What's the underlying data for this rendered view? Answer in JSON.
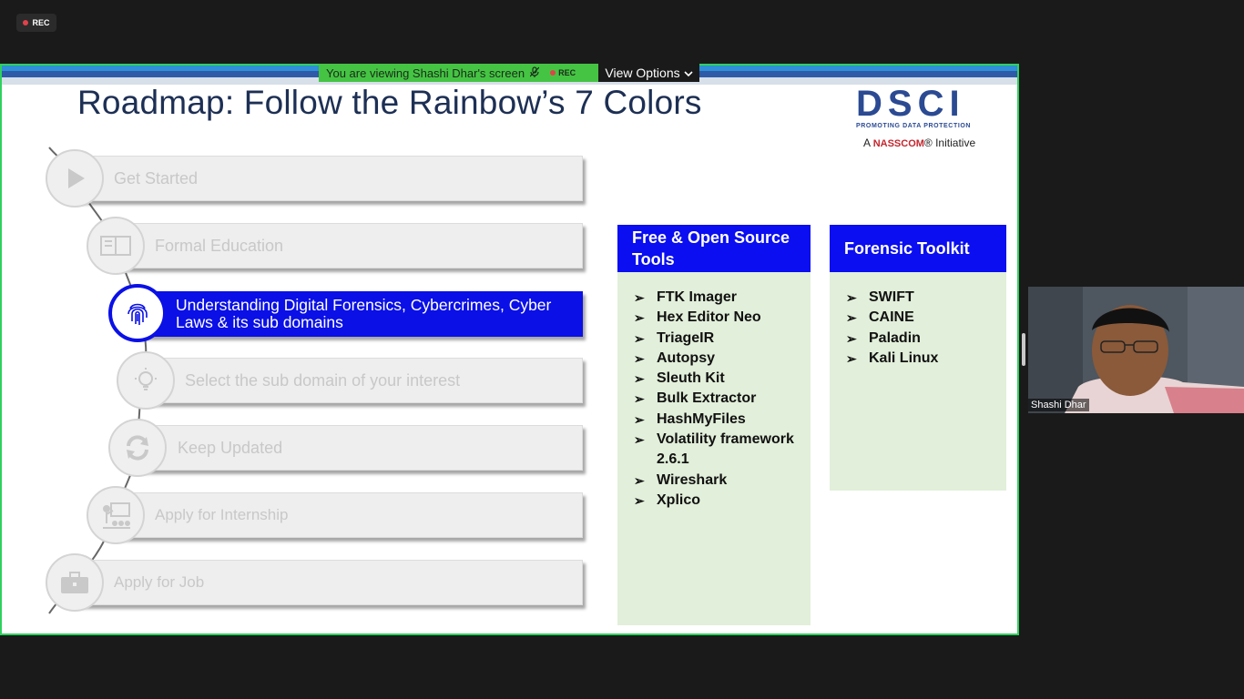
{
  "meeting": {
    "rec_label": "REC",
    "viewing_banner": "You are viewing Shashi Dhar's screen",
    "banner_rec_label": "REC",
    "view_options_label": "View Options",
    "participant_name": "Shashi Dhar"
  },
  "slide": {
    "title": "Roadmap: Follow the Rainbow’s 7 Colors",
    "logo": {
      "brand": "DSCI",
      "tagline": "PROMOTING DATA PROTECTION",
      "nasscom_prefix": "A",
      "nasscom_brand": "NASSCOM",
      "nasscom_suffix": "® Initiative"
    },
    "steps": [
      {
        "label": "Get Started",
        "icon": "play-icon",
        "active": false
      },
      {
        "label": "Formal Education",
        "icon": "book-icon",
        "active": false
      },
      {
        "label": "Understanding Digital Forensics, Cybercrimes, Cyber Laws & its sub domains",
        "icon": "fingerprint-icon",
        "active": true
      },
      {
        "label": "Select the sub domain of your interest",
        "icon": "lightbulb-icon",
        "active": false
      },
      {
        "label": "Keep Updated",
        "icon": "refresh-icon",
        "active": false
      },
      {
        "label": "Apply for Internship",
        "icon": "presentation-icon",
        "active": false
      },
      {
        "label": "Apply for Job",
        "icon": "briefcase-icon",
        "active": false
      }
    ],
    "free_tools": {
      "heading": "Free & Open Source Tools",
      "items": [
        "FTK Imager",
        "Hex Editor Neo",
        "TriageIR",
        "Autopsy",
        "Sleuth Kit",
        "Bulk Extractor",
        "HashMyFiles",
        "Volatility framework 2.6.1",
        "Wireshark",
        "Xplico"
      ]
    },
    "forensic_toolkit": {
      "heading": "Forensic Toolkit",
      "items": [
        "SWIFT",
        "CAINE",
        "Paladin",
        "Kali Linux"
      ]
    }
  }
}
